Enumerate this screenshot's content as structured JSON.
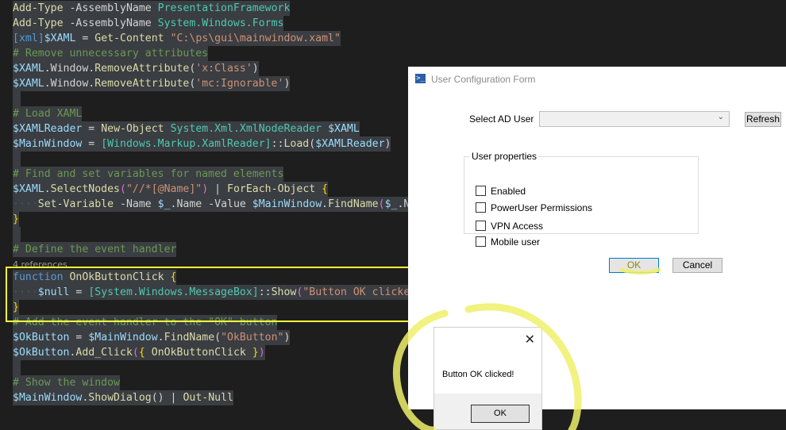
{
  "editor": {
    "lines": [
      {
        "t": "Add-Type -AssemblyName PresentationFramework"
      },
      {
        "t": "Add-Type -AssemblyName System.Windows.Forms"
      },
      {
        "t": "[xml]$XAML = Get-Content \"C:\\ps\\gui\\mainwindow.xaml\""
      },
      {
        "t": "# Remove unnecessary attributes"
      },
      {
        "t": "$XAML.Window.RemoveAttribute('x:Class')"
      },
      {
        "t": "$XAML.Window.RemoveAttribute('mc:Ignorable')"
      },
      {
        "t": ""
      },
      {
        "t": "# Load XAML"
      },
      {
        "t": "$XAMLReader = New-Object System.Xml.XmlNodeReader $XAML"
      },
      {
        "t": "$MainWindow = [Windows.Markup.XamlReader]::Load($XAMLReader)"
      },
      {
        "t": ""
      },
      {
        "t": "# Find and set variables for named elements"
      },
      {
        "t": "$XAML.SelectNodes(\"//*[@Name]\") | ForEach-Object {"
      },
      {
        "t": "    Set-Variable -Name $_.Name -Value $MainWindow.FindName($_.Nam"
      },
      {
        "t": "}"
      },
      {
        "t": ""
      },
      {
        "t": "# Define the event handler"
      },
      {
        "t": "4 references"
      },
      {
        "t": "function OnOkButtonClick {"
      },
      {
        "t": "    $null = [System.Windows.MessageBox]::Show(\"Button OK clicked"
      },
      {
        "t": "}"
      },
      {
        "t": "# Add the event handler to the \"OK\" button"
      },
      {
        "t": "$OkButton = $MainWindow.FindName(\"OkButton\")"
      },
      {
        "t": "$OkButton.Add_Click({ OnOkButtonClick })"
      },
      {
        "t": ""
      },
      {
        "t": "# Show the window"
      },
      {
        "t": "$MainWindow.ShowDialog() | Out-Null"
      }
    ]
  },
  "form": {
    "title": "User Configuration Form",
    "icon": "powershell-icon",
    "select_label": "Select AD User",
    "combo_value": "",
    "refresh_label": "Refresh",
    "group_label": "User properties",
    "checkboxes": [
      {
        "label": "Enabled",
        "checked": false
      },
      {
        "label": "PowerUser Permissions",
        "checked": false
      },
      {
        "label": "VPN Access",
        "checked": false
      },
      {
        "label": "Mobile user",
        "checked": false
      }
    ],
    "ok_label": "OK",
    "cancel_label": "Cancel"
  },
  "msgbox": {
    "close_glyph": "✕",
    "text": "Button OK clicked!",
    "ok_label": "OK"
  },
  "colors": {
    "highlight": "#ffff3a",
    "editor_bg": "#1e1e1e"
  }
}
